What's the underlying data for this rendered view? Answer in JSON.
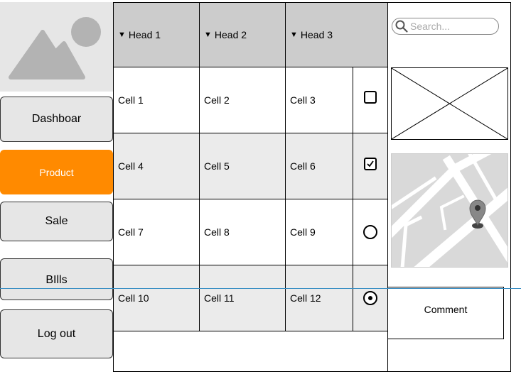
{
  "sidebar": {
    "items": [
      {
        "label": "Dashboar",
        "active": false
      },
      {
        "label": "Product",
        "active": true
      },
      {
        "label": "Sale",
        "active": false
      },
      {
        "label": "BIlls",
        "active": false
      },
      {
        "label": "Log out",
        "active": false
      }
    ]
  },
  "table": {
    "headers": [
      "Head 1",
      "Head 2",
      "Head 3"
    ],
    "sort_icon": "triangle-down-icon",
    "rows": [
      {
        "cells": [
          "Cell 1",
          "Cell 2",
          "Cell 3"
        ],
        "control": "checkbox",
        "checked": false
      },
      {
        "cells": [
          "Cell 4",
          "Cell 5",
          "Cell 6"
        ],
        "control": "checkbox",
        "checked": true
      },
      {
        "cells": [
          "Cell 7",
          "Cell 8",
          "Cell 9"
        ],
        "control": "radio",
        "checked": false
      },
      {
        "cells": [
          "Cell 10",
          "Cell 11",
          "Cell 12"
        ],
        "control": "radio",
        "checked": true
      }
    ]
  },
  "search": {
    "placeholder": "Search..."
  },
  "comment": {
    "label": "Comment"
  },
  "colors": {
    "accent": "#ff8a00",
    "header_bg": "#cccccc",
    "row_alt_bg": "#ebebeb",
    "button_bg": "#e6e6e6",
    "guide_line": "#3a8fc4"
  }
}
